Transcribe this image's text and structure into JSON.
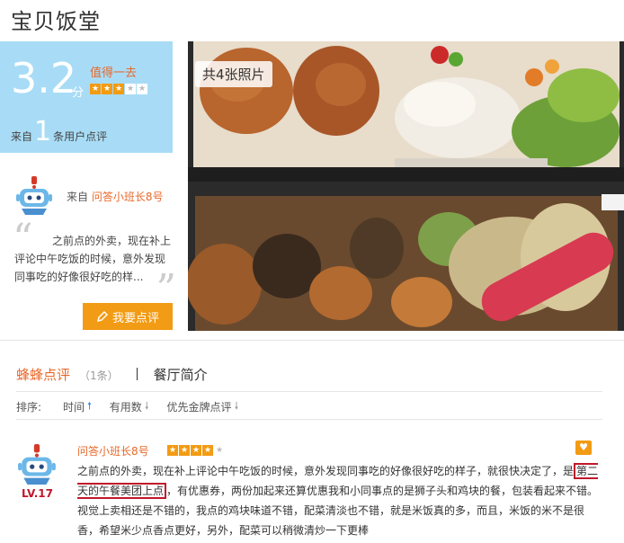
{
  "restaurant": {
    "name": "宝贝饭堂"
  },
  "score": {
    "value": "3.2",
    "unit": "分",
    "tag": "值得一去",
    "stars_filled": 3,
    "stars_total": 5,
    "from_prefix": "来自",
    "review_count": "1",
    "from_suffix": "条用户点评"
  },
  "featured": {
    "from_label": "来自",
    "username": "问答小班长8号",
    "quote": "之前点的外卖，现在补上评论中午吃饭的时候，意外发现同事吃的好像很好吃的样..."
  },
  "write_review_button": "我要点评",
  "photo": {
    "badge": "共4张照片"
  },
  "tabs": {
    "reviews_label": "蜂蜂点评",
    "reviews_count": "（1条）",
    "intro_label": "餐厅简介"
  },
  "sort": {
    "label": "排序:",
    "options": [
      "时间",
      "有用数",
      "优先金牌点评"
    ]
  },
  "review": {
    "username": "问答小班长8号",
    "level": "LV.17",
    "stars_filled": 4,
    "stars_total": 5,
    "text_part1": "之前点的外卖，现在补上评论中午吃饭的时候，意外发现同事吃的好像很好吃的样子，就很快决定了，是",
    "text_highlight": "第二天的午餐美团上点",
    "text_part2": "，有优惠券，两份加起来还算优惠我和小同事点的是狮子头和鸡块的餐，包装看起来不错。视觉上卖相还是不错的，我点的鸡块味道不错，配菜清淡也不错，就是米饭真的多，而且，米饭的米不是很香，希望米少点香点更好，另外，配菜可以稍微清炒一下更棒"
  },
  "colors": {
    "accent_orange": "#e8682a",
    "button_orange": "#f29b14",
    "score_bg": "#a8dcf6",
    "level_red": "#c0182a",
    "link_blue": "#2a8ae0"
  }
}
